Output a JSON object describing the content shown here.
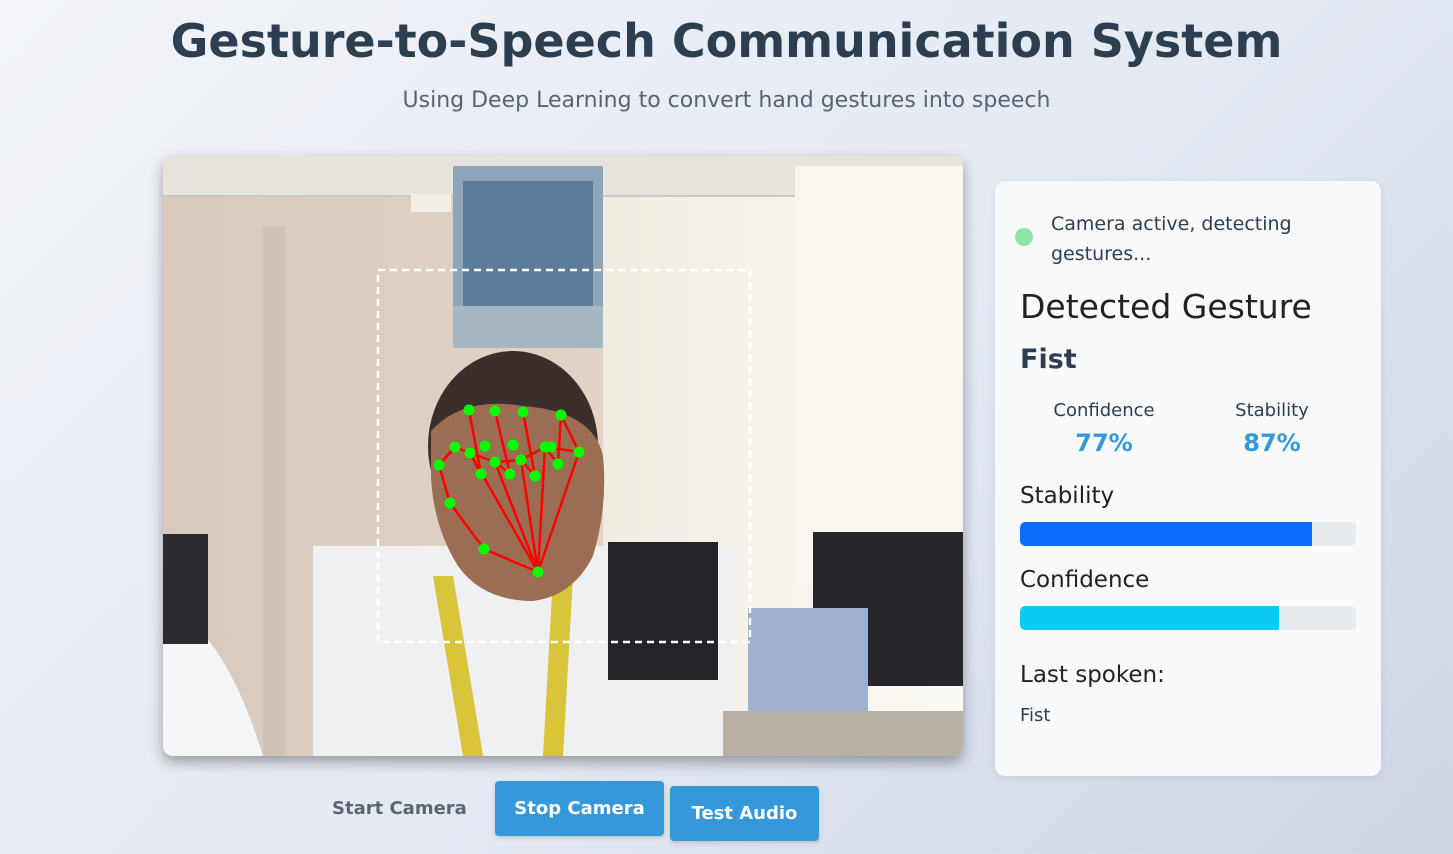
{
  "header": {
    "title": "Gesture-to-Speech Communication System",
    "subtitle": "Using Deep Learning to convert hand gestures into speech"
  },
  "controls": {
    "start_label": "Start Camera",
    "stop_label": "Stop Camera",
    "test_label": "Test Audio"
  },
  "status": {
    "text": "Camera active, detecting gestures...",
    "dot_color": "#8fe3a4"
  },
  "detection": {
    "heading": "Detected Gesture",
    "gesture": "Fist",
    "confidence_label": "Confidence",
    "confidence_value": "77%",
    "stability_label": "Stability",
    "stability_value": "87%"
  },
  "bars": {
    "stability_label": "Stability",
    "stability_fraction": 0.87,
    "stability_color": "#0d6efd",
    "confidence_label": "Confidence",
    "confidence_fraction": 0.77,
    "confidence_color": "#0dcaf0"
  },
  "last_spoken": {
    "label": "Last spoken:",
    "value": "Fist"
  },
  "camera_feed": {
    "landmark_color": "#00ff00",
    "connection_color": "#ff0000",
    "roi_style": "dashed-white"
  }
}
